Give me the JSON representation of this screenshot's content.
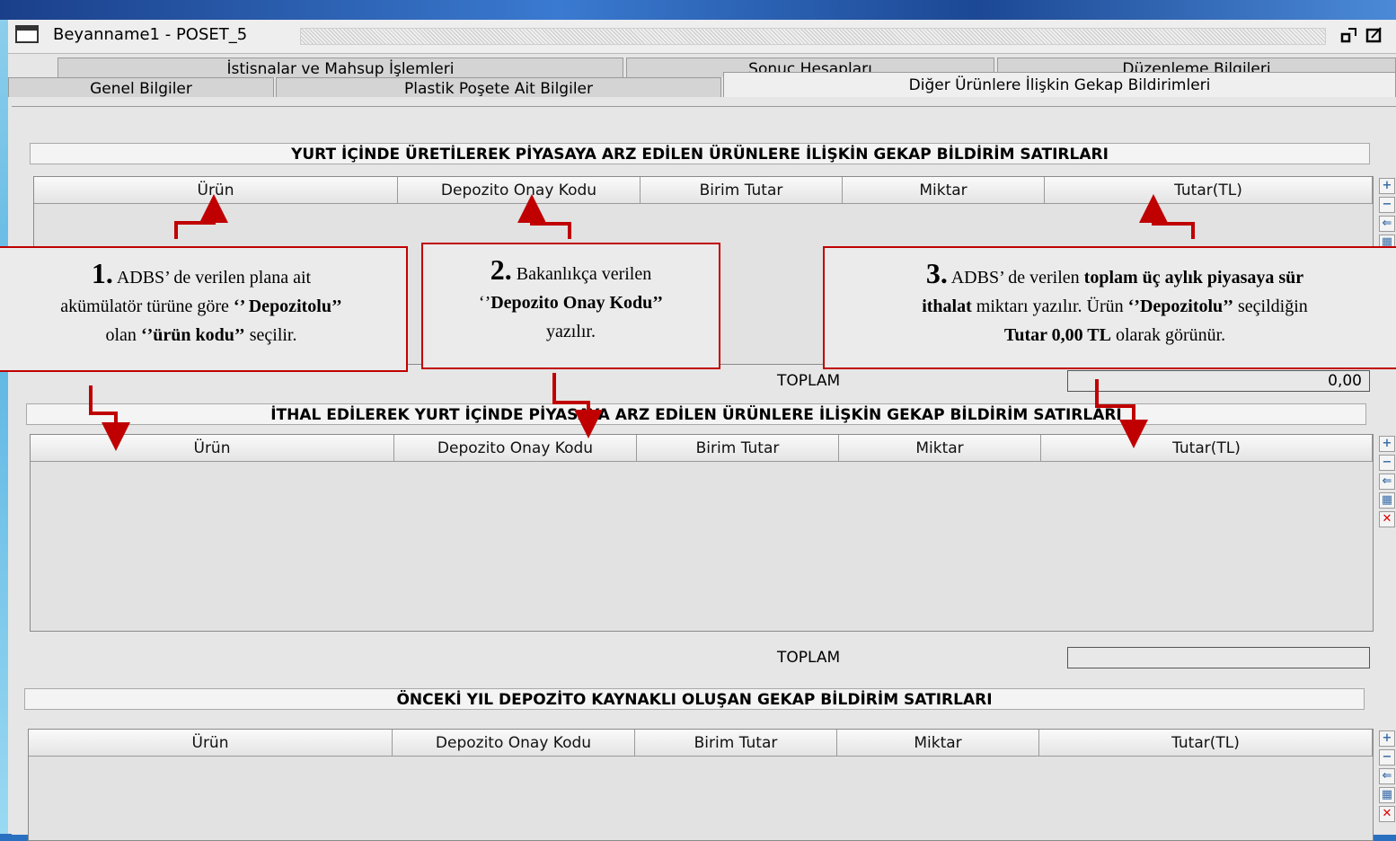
{
  "window": {
    "title": "Beyanname1 - POSET_5",
    "icon": "window-icon",
    "buttons": [
      "restore-icon",
      "maximize-icon"
    ]
  },
  "tabs": {
    "row1": [
      {
        "label": "İstisnalar ve Mahsup İşlemleri"
      },
      {
        "label": "Sonuç Hesapları"
      },
      {
        "label": "Düzenleme Bilgileri"
      }
    ],
    "row2": [
      {
        "label": "Genel Bilgiler"
      },
      {
        "label": "Plastik Poşete Ait Bilgiler"
      },
      {
        "label": "Diğer Ürünlere İlişkin Gekap Bildirimleri",
        "active": true
      }
    ]
  },
  "columns": [
    "Ürün",
    "Depozito Onay Kodu",
    "Birim Tutar",
    "Miktar",
    "Tutar(TL)"
  ],
  "sections": [
    {
      "title": "YURT İÇİNDE ÜRETİLEREK PİYASAYA ARZ EDİLEN ÜRÜNLERE İLİŞKİN GEKAP BİLDİRİM SATIRLARI",
      "toplam_label": "TOPLAM",
      "toplam_value": "0,00"
    },
    {
      "title": "İTHAL EDİLEREK YURT İÇİNDE PİYASAYA ARZ EDİLEN ÜRÜNLERE İLİŞKİN GEKAP BİLDİRİM SATIRLARI",
      "toplam_label": "TOPLAM",
      "toplam_value": ""
    },
    {
      "title": "ÖNCEKİ YIL DEPOZİTO KAYNAKLI OLUŞAN GEKAP BİLDİRİM SATIRLARI"
    }
  ],
  "grid_toolbar": [
    "add-row-icon",
    "remove-row-icon",
    "move-up-icon",
    "import-icon",
    "delete-icon"
  ],
  "callouts": [
    {
      "num": "1.",
      "line1": "ADBS’ de verilen plana ait",
      "line2_a": "akümülatör türüne göre ",
      "line2_b": "‘’ Depozitolu’’",
      "line3_a": "olan ",
      "line3_b": "‘’ürün kodu’’",
      "line3_c": " seçilir."
    },
    {
      "num": "2.",
      "line1": "Bakanlıkça verilen",
      "line2_a": "‘’",
      "line2_b": "Depozito Onay Kodu’’",
      "line3": "yazılır."
    },
    {
      "num": "3.",
      "line1_a": "ADBS’ de verilen ",
      "line1_b": "toplam üç aylık piyasaya sür",
      "line2_a": "ithalat",
      "line2_b": " miktarı yazılır. Ürün ",
      "line2_c": "‘’Depozitolu’’",
      "line2_d": " seçildiğin",
      "line3_a": "Tutar  0,00 TL",
      "line3_b": " olarak görünür."
    }
  ],
  "colors": {
    "callout_border": "#c00000",
    "arrow": "#c00000"
  }
}
